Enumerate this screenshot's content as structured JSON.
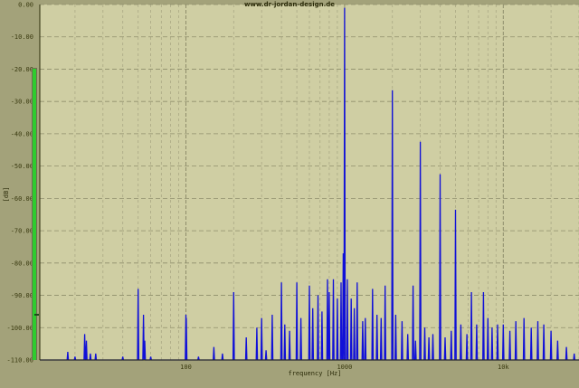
{
  "colors": {
    "background": "#a3a27a",
    "plot_background": "#cfcea3",
    "grid_major": "#8f8e6c",
    "grid_minor": "#aba985",
    "trace": "#1010d8",
    "level_bar": "#2ecc2e"
  },
  "header": {
    "url_text": "www.dr-jordan-design.de"
  },
  "level_meter": {
    "name": "level-meter",
    "peak_db": -96
  },
  "chart_data": {
    "type": "line",
    "title": "",
    "xlabel": "frequency [Hz]",
    "ylabel": "[dB]",
    "x_scale": "log",
    "xlim": [
      12,
      30000
    ],
    "ylim": [
      -110,
      0
    ],
    "grid": true,
    "y_ticks": [
      0,
      -10,
      -20,
      -30,
      -40,
      -50,
      -60,
      -70,
      -80,
      -90,
      -100,
      -110
    ],
    "y_tick_labels": [
      "0.00",
      "-10.00",
      "-20.00",
      "-30.00",
      "-40.00",
      "-50.00",
      "-60.00",
      "-70.00",
      "-80.00",
      "-90.00",
      "-100.00",
      "-110.00"
    ],
    "x_ticks": [
      100,
      1000,
      10000
    ],
    "x_tick_labels": [
      "100",
      "1000",
      "10k"
    ],
    "noise_floor": -110,
    "series": [
      {
        "peaks": [
          [
            18,
            -107.5
          ],
          [
            20,
            -109
          ],
          [
            23,
            -102
          ],
          [
            23.6,
            -104
          ],
          [
            25,
            -108
          ],
          [
            27,
            -108
          ],
          [
            40,
            -109
          ],
          [
            50,
            -88
          ],
          [
            54,
            -96
          ],
          [
            55,
            -104
          ],
          [
            60,
            -109
          ],
          [
            100,
            -96
          ],
          [
            100.5,
            -97
          ],
          [
            120,
            -109
          ],
          [
            150,
            -106
          ],
          [
            170,
            -108
          ],
          [
            200,
            -89
          ],
          [
            240,
            -103
          ],
          [
            280,
            -100
          ],
          [
            300,
            -97
          ],
          [
            320,
            -107
          ],
          [
            350,
            -96
          ],
          [
            400,
            -86
          ],
          [
            420,
            -99
          ],
          [
            450,
            -101
          ],
          [
            500,
            -86
          ],
          [
            530,
            -97
          ],
          [
            600,
            -87
          ],
          [
            630,
            -94
          ],
          [
            680,
            -90
          ],
          [
            720,
            -95
          ],
          [
            780,
            -85
          ],
          [
            800,
            -89
          ],
          [
            850,
            -85
          ],
          [
            900,
            -91
          ],
          [
            950,
            -86
          ],
          [
            980,
            -77
          ],
          [
            1000,
            -1
          ],
          [
            1040,
            -85
          ],
          [
            1100,
            -91
          ],
          [
            1150,
            -94
          ],
          [
            1200,
            -86
          ],
          [
            1300,
            -98
          ],
          [
            1350,
            -97
          ],
          [
            1500,
            -88
          ],
          [
            1600,
            -96
          ],
          [
            1700,
            -97
          ],
          [
            1800,
            -87
          ],
          [
            2000,
            -26.5
          ],
          [
            2100,
            -96
          ],
          [
            2300,
            -98
          ],
          [
            2500,
            -102
          ],
          [
            2700,
            -87
          ],
          [
            2800,
            -104
          ],
          [
            3000,
            -42.5
          ],
          [
            3200,
            -100
          ],
          [
            3400,
            -103
          ],
          [
            3600,
            -102
          ],
          [
            4000,
            -52.5
          ],
          [
            4300,
            -103
          ],
          [
            4700,
            -101
          ],
          [
            5000,
            -63.5
          ],
          [
            5400,
            -99
          ],
          [
            5900,
            -102
          ],
          [
            6300,
            -89
          ],
          [
            6800,
            -99
          ],
          [
            7500,
            -89
          ],
          [
            8000,
            -97
          ],
          [
            8500,
            -100
          ],
          [
            9200,
            -99
          ],
          [
            10000,
            -99
          ],
          [
            11000,
            -101
          ],
          [
            12000,
            -98
          ],
          [
            13500,
            -97
          ],
          [
            15000,
            -100
          ],
          [
            16500,
            -98
          ],
          [
            18000,
            -99
          ],
          [
            20000,
            -101
          ],
          [
            22000,
            -104
          ],
          [
            25000,
            -106
          ],
          [
            28000,
            -108
          ]
        ]
      }
    ]
  }
}
